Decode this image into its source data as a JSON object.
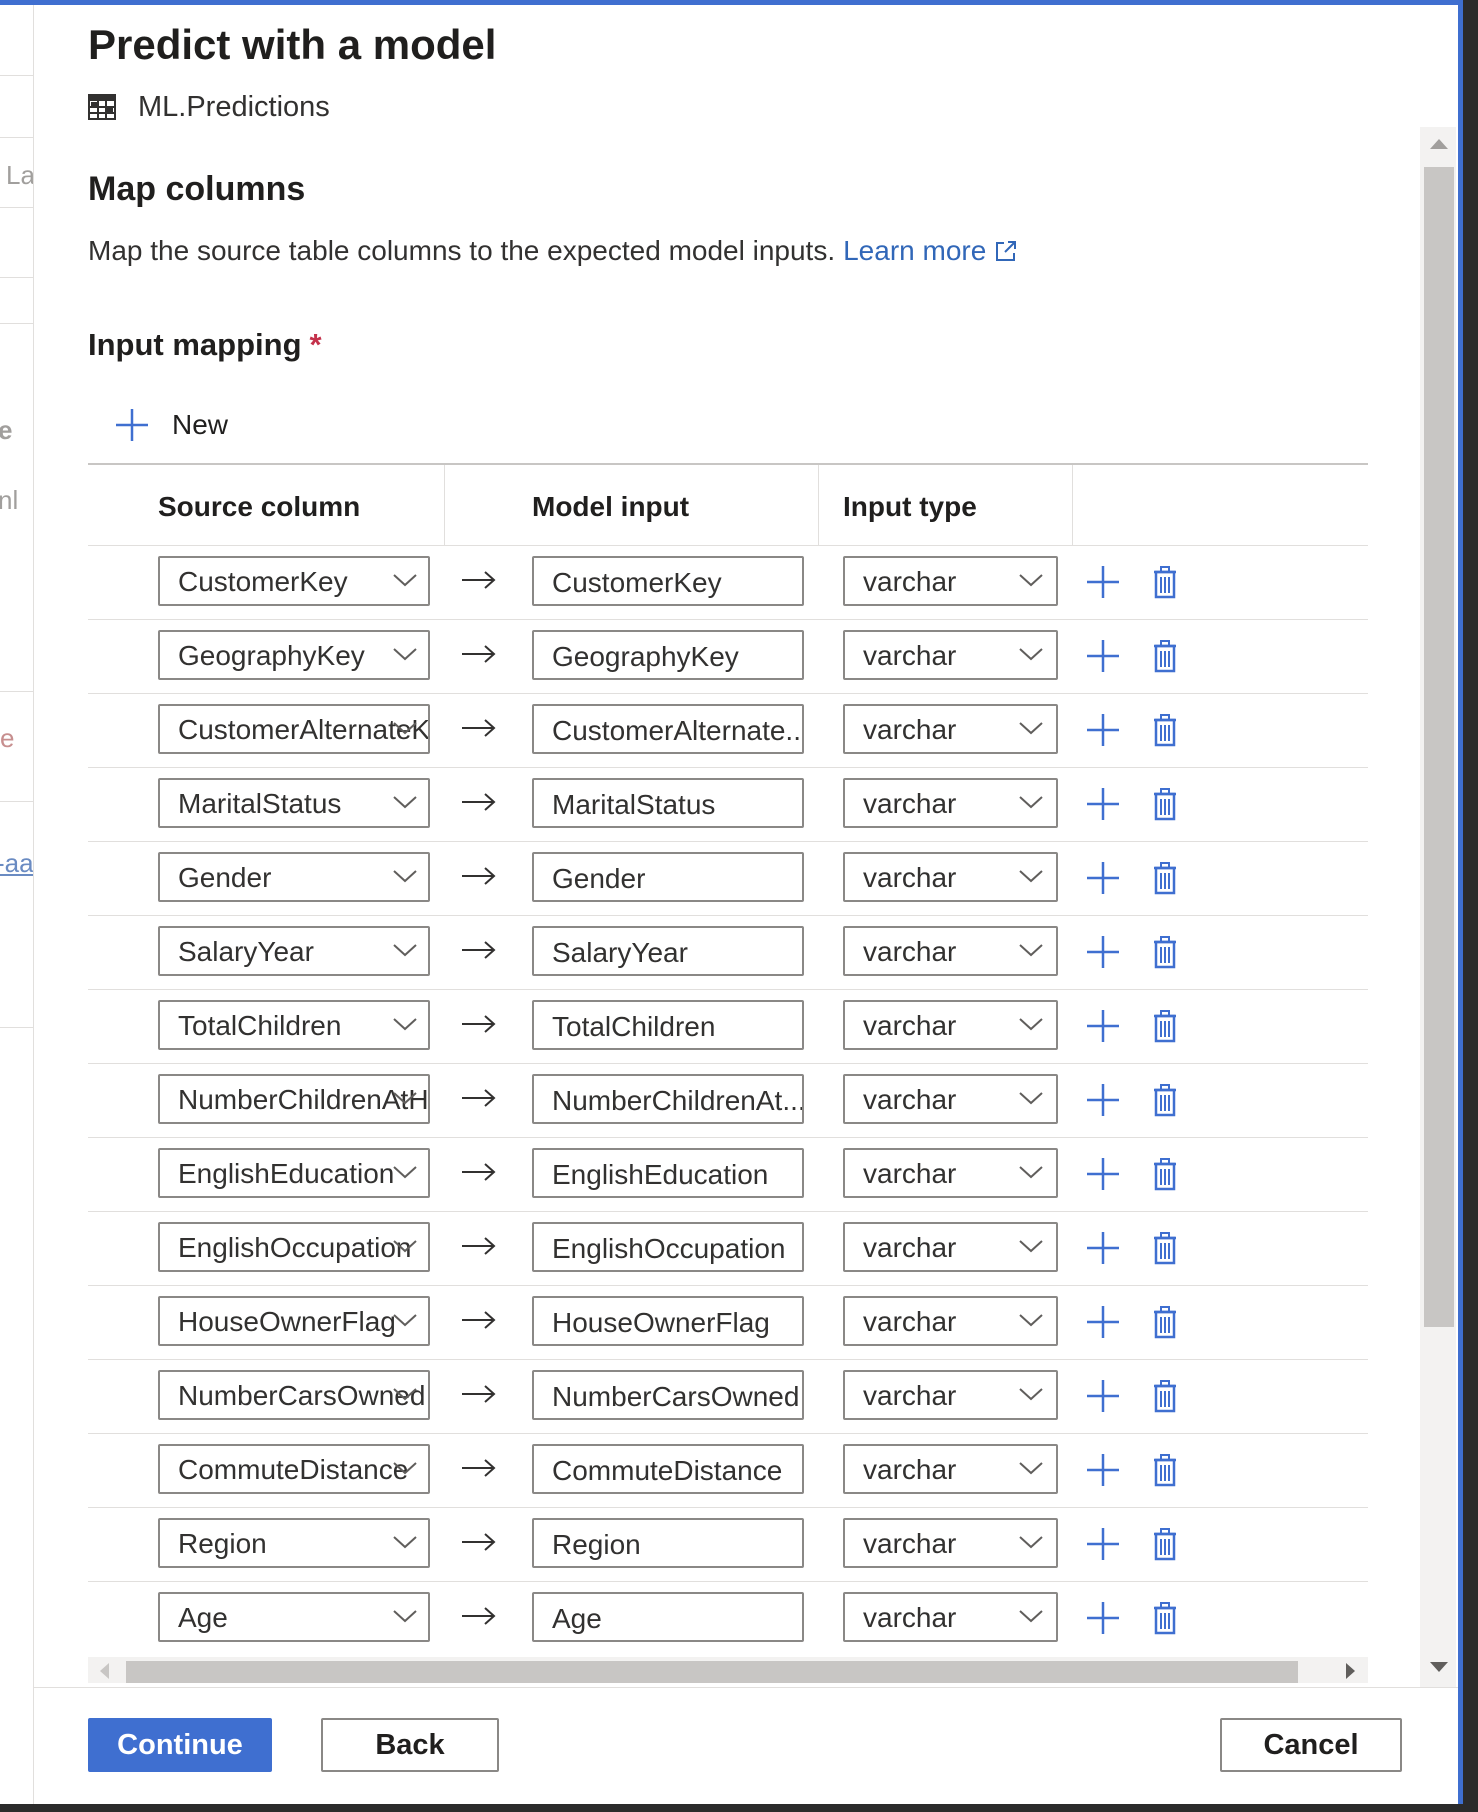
{
  "background": {
    "fragments": [
      "La",
      "e",
      "nl",
      "e",
      "-aa"
    ]
  },
  "dialog": {
    "title": "Predict with a model",
    "model_name": "ML.Predictions",
    "section_title": "Map columns",
    "description": "Map the source table columns to the expected model inputs.",
    "learn_more": "Learn more",
    "input_mapping_label": "Input mapping",
    "required_marker": "*",
    "new_label": "New"
  },
  "table": {
    "headers": {
      "source": "Source column",
      "model": "Model input",
      "type": "Input type"
    },
    "rows": [
      {
        "source": "CustomerKey",
        "model": "CustomerKey",
        "type": "varchar"
      },
      {
        "source": "GeographyKey",
        "model": "GeographyKey",
        "type": "varchar"
      },
      {
        "source": "CustomerAlternateKey",
        "model": "CustomerAlternate...",
        "type": "varchar"
      },
      {
        "source": "MaritalStatus",
        "model": "MaritalStatus",
        "type": "varchar"
      },
      {
        "source": "Gender",
        "model": "Gender",
        "type": "varchar"
      },
      {
        "source": "SalaryYear",
        "model": "SalaryYear",
        "type": "varchar"
      },
      {
        "source": "TotalChildren",
        "model": "TotalChildren",
        "type": "varchar"
      },
      {
        "source": "NumberChildrenAtHome",
        "model": "NumberChildrenAt...",
        "type": "varchar"
      },
      {
        "source": "EnglishEducation",
        "model": "EnglishEducation",
        "type": "varchar"
      },
      {
        "source": "EnglishOccupation",
        "model": "EnglishOccupation",
        "type": "varchar"
      },
      {
        "source": "HouseOwnerFlag",
        "model": "HouseOwnerFlag",
        "type": "varchar"
      },
      {
        "source": "NumberCarsOwned",
        "model": "NumberCarsOwned",
        "type": "varchar"
      },
      {
        "source": "CommuteDistance",
        "model": "CommuteDistance",
        "type": "varchar"
      },
      {
        "source": "Region",
        "model": "Region",
        "type": "varchar"
      },
      {
        "source": "Age",
        "model": "Age",
        "type": "varchar"
      }
    ]
  },
  "footer": {
    "continue": "Continue",
    "back": "Back",
    "cancel": "Cancel"
  },
  "colors": {
    "accent": "#3f6fd0",
    "link": "#3167b8",
    "required": "#c4314b"
  },
  "icons": [
    "table-icon",
    "external-link-icon",
    "plus-icon",
    "chevron-down-icon",
    "arrow-right-icon",
    "delete-icon"
  ]
}
